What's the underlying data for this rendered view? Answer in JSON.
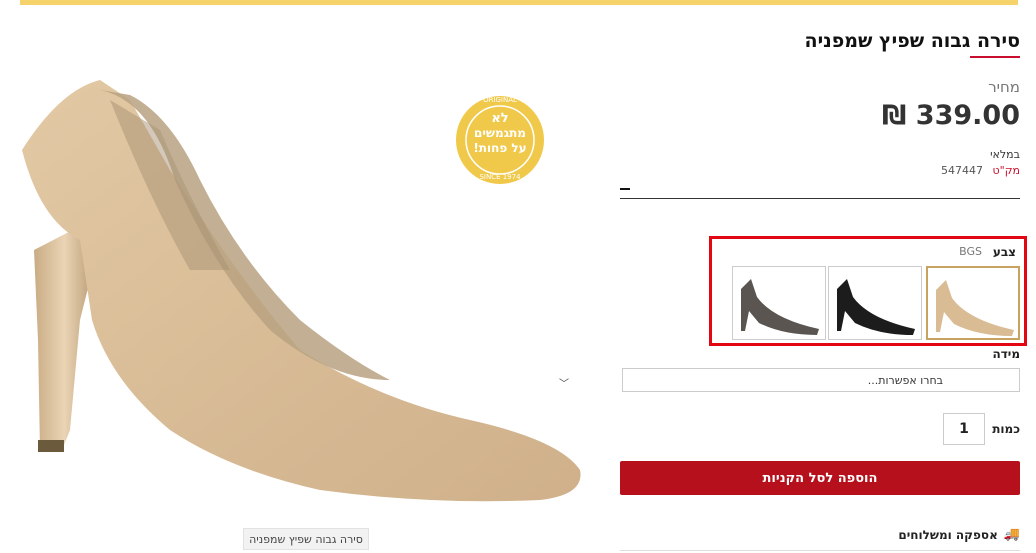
{
  "product": {
    "title": "סירה גבוה שפיץ שמפניה",
    "price_label": "מחיר",
    "price": "339.00 ₪",
    "stock_status": "במלאי",
    "sku_label": "מק\"ט",
    "sku_value": "547447"
  },
  "media": {
    "caption": "סירה גבוה שפיץ שמפניה",
    "seal_text_1": "לא",
    "seal_text_2": "מתגמשים",
    "seal_text_3": "על פחות!",
    "seal_ring_top": "ORIGINAL",
    "seal_ring_bottom": "SINCE 1974"
  },
  "options": {
    "color_label": "צבע",
    "color_value": "BGS",
    "swatches": [
      {
        "name": "champagne",
        "selected": true
      },
      {
        "name": "black",
        "selected": false
      },
      {
        "name": "glitter-gray",
        "selected": false
      }
    ],
    "size_label": "מידה",
    "size_placeholder": "בחרו אפשרות...",
    "qty_label": "כמות",
    "qty_value": "1",
    "add_to_cart": "הוספה לסל הקניות"
  },
  "shipping": {
    "label": "אספקה ומשלוחים",
    "icon": "truck-icon"
  },
  "colors": {
    "accent_bar": "#f5d36a",
    "cta": "#b5101c",
    "highlight": "#e30613",
    "shoe": "#d9bb94"
  }
}
